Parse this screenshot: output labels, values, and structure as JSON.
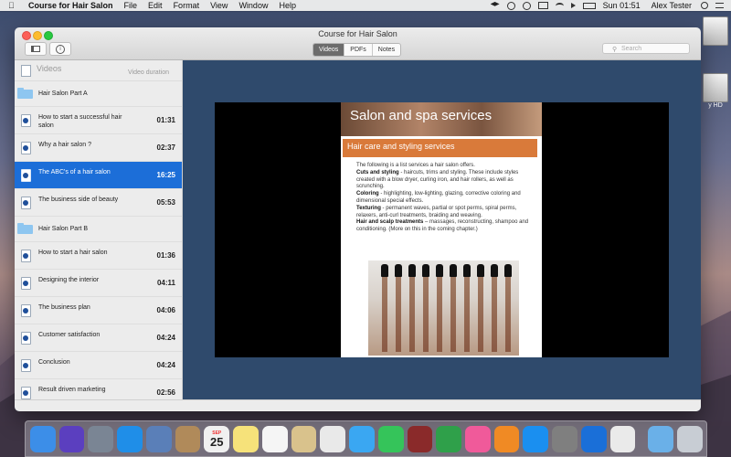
{
  "menubar": {
    "app_name": "Course for Hair Salon",
    "menus": [
      "File",
      "Edit",
      "Format",
      "View",
      "Window",
      "Help"
    ],
    "clock": "Sun 01:51",
    "user": "Alex Tester"
  },
  "desktop": {
    "drives": [
      "",
      "y HD"
    ]
  },
  "window": {
    "title": "Course for Hair Salon",
    "tabs": [
      "Videos",
      "PDFs",
      "Notes"
    ],
    "active_tab": "Videos",
    "search_placeholder": "Search"
  },
  "sidebar": {
    "header_title": "Videos",
    "header_duration": "Video duration",
    "rows": [
      {
        "type": "group",
        "label": "Hair Salon Part A"
      },
      {
        "type": "video",
        "label": "How to start a successful hair salon",
        "duration": "01:31"
      },
      {
        "type": "video",
        "label": "Why a hair salon ?",
        "duration": "02:37"
      },
      {
        "type": "video",
        "label": "The ABC's of a hair salon",
        "duration": "16:25",
        "selected": true
      },
      {
        "type": "video",
        "label": "The business side of beauty",
        "duration": "05:53"
      },
      {
        "type": "group",
        "label": "Hair Salon Part B"
      },
      {
        "type": "video",
        "label": "How to start a hair salon",
        "duration": "01:36"
      },
      {
        "type": "video",
        "label": "Designing the interior",
        "duration": "04:11"
      },
      {
        "type": "video",
        "label": "The business plan",
        "duration": "04:06"
      },
      {
        "type": "video",
        "label": "Customer satisfaction",
        "duration": "04:24"
      },
      {
        "type": "video",
        "label": "Conclusion",
        "duration": "04:24"
      },
      {
        "type": "video",
        "label": "Result driven marketing",
        "duration": "02:56"
      }
    ]
  },
  "slide": {
    "title": "Salon and spa services",
    "subtitle": "Hair care and styling services",
    "intro": "The following is a list services a hair salon offers.",
    "items": [
      {
        "keyword": "Cuts and styling",
        "text": " - haircuts, trims and styling. These include styles created with a blow dryer, curling iron, and hair rollers, as well as scrunching."
      },
      {
        "keyword": "Coloring",
        "text": " - highlighting, low-lighting, glazing, corrective coloring and dimensional special effects."
      },
      {
        "keyword": "Texturing",
        "text": " - permanent waves, partial or spot perms, spiral perms, relaxers, anti-curl treatments, braiding and weaving."
      },
      {
        "keyword": "Hair and scalp treatments",
        "text": " – massages, reconstructing, shampoo and conditioning. (More on this in the coming chapter.)"
      }
    ]
  },
  "dock": {
    "icons": [
      {
        "name": "finder-icon",
        "color": "#3c8ee8"
      },
      {
        "name": "siri-icon",
        "color": "#5b3fbf"
      },
      {
        "name": "launchpad-icon",
        "color": "#7a8594"
      },
      {
        "name": "safari-icon",
        "color": "#1f8ee8"
      },
      {
        "name": "mail-icon",
        "color": "#5a7fb8"
      },
      {
        "name": "contacts-icon",
        "color": "#b08a5a"
      },
      {
        "name": "calendar-icon",
        "color": "#f0f0f0"
      },
      {
        "name": "notes-icon",
        "color": "#f6e27a"
      },
      {
        "name": "reminders-icon",
        "color": "#f5f5f5"
      },
      {
        "name": "preview-icon",
        "color": "#d9c28c"
      },
      {
        "name": "photos-icon",
        "color": "#e9e9e9"
      },
      {
        "name": "messages-icon",
        "color": "#3aa7f2"
      },
      {
        "name": "facetime-icon",
        "color": "#35c45a"
      },
      {
        "name": "photo-booth-icon",
        "color": "#8a2a2a"
      },
      {
        "name": "numbers-icon",
        "color": "#2fa04a"
      },
      {
        "name": "itunes-icon",
        "color": "#f05a9a"
      },
      {
        "name": "ibooks-icon",
        "color": "#f08a24"
      },
      {
        "name": "app-store-icon",
        "color": "#1a8ff0"
      },
      {
        "name": "system-preferences-icon",
        "color": "#7f7f7f"
      },
      {
        "name": "teamviewer-icon",
        "color": "#1a6fd8"
      },
      {
        "name": "course-app-icon",
        "color": "#eaeaea"
      },
      {
        "name": "downloads-folder-icon",
        "color": "#6ab0e8"
      },
      {
        "name": "trash-icon",
        "color": "#c8cdd4"
      }
    ],
    "calendar_month": "SEP",
    "calendar_day": "25"
  }
}
